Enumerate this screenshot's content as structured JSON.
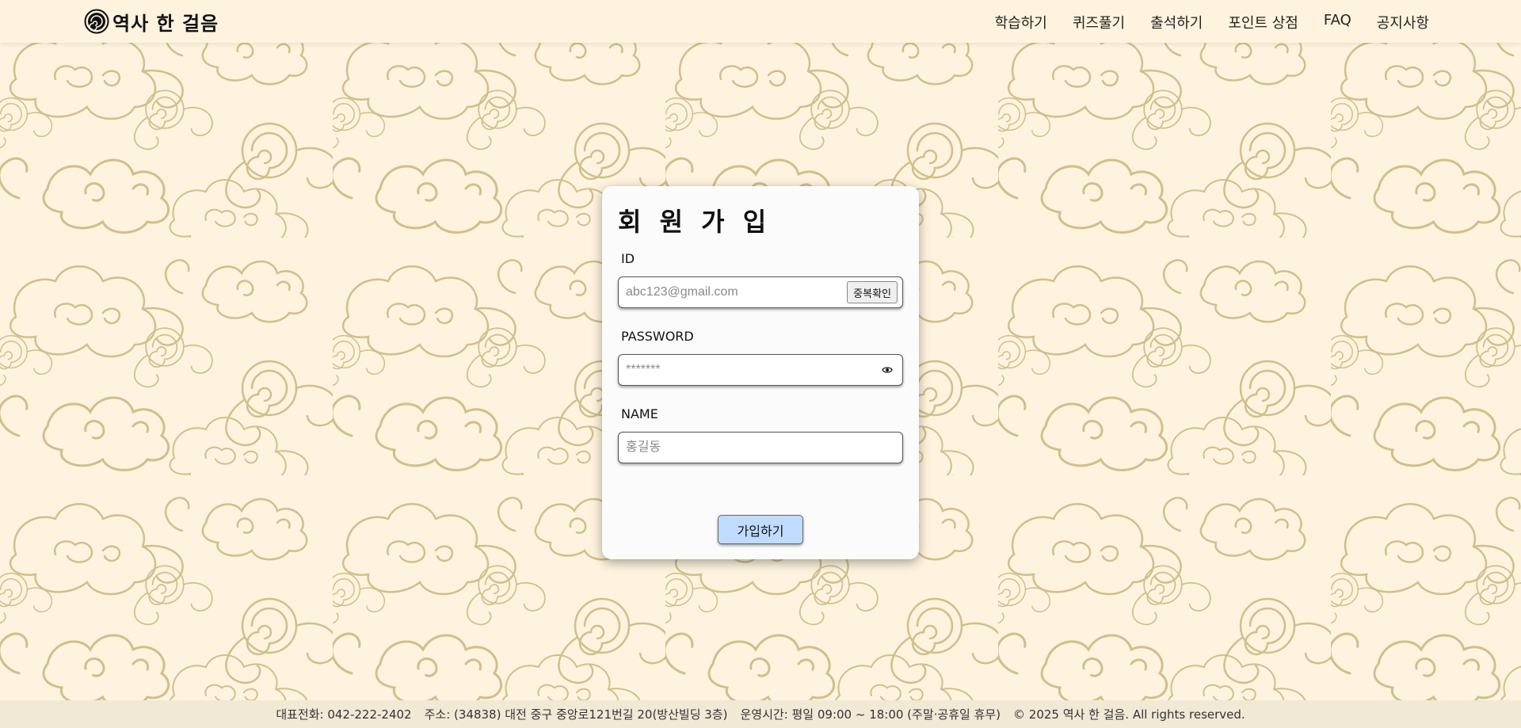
{
  "header": {
    "logo_text": "역사 한 걸음",
    "logo_icon": "spiral-emblem-icon",
    "nav": [
      {
        "label": "학습하기"
      },
      {
        "label": "퀴즈풀기"
      },
      {
        "label": "출석하기"
      },
      {
        "label": "포인트 상점"
      },
      {
        "label": "FAQ"
      },
      {
        "label": "공지사항"
      }
    ]
  },
  "signup": {
    "title": "회 원 가 입",
    "id_label": "ID",
    "id_placeholder": "abc123@gmail.com",
    "dup_check_label": "중복확인",
    "password_label": "PASSWORD",
    "password_placeholder": "*******",
    "password_toggle_icon": "eye-icon",
    "name_label": "NAME",
    "name_placeholder": "홍길동",
    "submit_label": "가입하기"
  },
  "footer": {
    "phone": "대표전화: 042-222-2402",
    "address": "주소: (34838) 대전 중구 중앙로121번길 20(방산빌딩 3층)",
    "hours": "운영시간: 평일 09:00 ~ 18:00 (주말·공휴일 휴무)",
    "copyright": "© 2025 역사 한 걸음. All rights reserved."
  },
  "colors": {
    "background": "#fdf3de",
    "cloud_stroke": "#cfc08a",
    "card": "#fbfbfb",
    "submit_button": "#bfdcff",
    "footer": "#f2e8d6"
  }
}
